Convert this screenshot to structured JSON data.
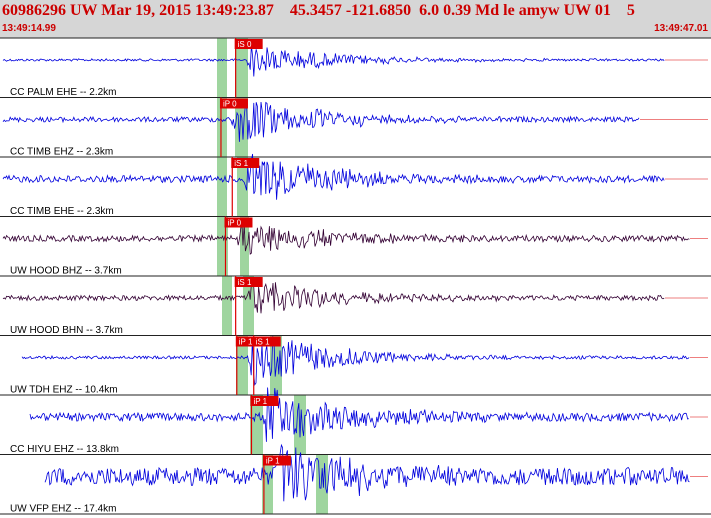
{
  "header": {
    "title": "60986296 UW Mar 19, 2015 13:49:23.87    45.3457 -121.6850  6.0 0.39 Md le amyw UW 01    5",
    "start_time": "13:49:14.99",
    "end_time": "13:49:47.01"
  },
  "colors": {
    "header_bg": "#d6d6d6",
    "header_text": "#cc0000",
    "trace_blue": "#0000dd",
    "trace_purple": "#330033",
    "pick_red": "#dd0000",
    "window_green": "#9fd59f",
    "separator": "#222222"
  },
  "traces": [
    {
      "label": "CC PALM EHE -- 2.2km",
      "picks": [
        {
          "label": "iS 0",
          "time": 18.2
        }
      ]
    },
    {
      "label": "CC TIMB EHZ -- 2.3km",
      "picks": [
        {
          "label": "iP 0",
          "time": 16.9
        }
      ]
    },
    {
      "label": "CC TIMB EHE -- 2.3km",
      "picks": [
        {
          "label": "iS 1",
          "time": 17.9
        }
      ]
    },
    {
      "label": "UW HOOD BHZ -- 3.7km",
      "picks": [
        {
          "label": "iP 0",
          "time": 17.3
        }
      ]
    },
    {
      "label": "UW HOOD BHN -- 3.7km",
      "picks": [
        {
          "label": "iS 1",
          "time": 18.2
        }
      ]
    },
    {
      "label": "UW TDH EHZ -- 10.4km",
      "picks": [
        {
          "label": "iP 1",
          "time": 18.3
        },
        {
          "label": "iS 1",
          "time": 19.8
        }
      ]
    },
    {
      "label": "CC HIYU EHZ -- 13.8km",
      "picks": [
        {
          "label": "iP 1",
          "time": 19.6
        }
      ]
    },
    {
      "label": "UW VFP EHZ -- 17.4km",
      "picks": [
        {
          "label": "iP 1",
          "time": 20.7
        }
      ]
    }
  ]
}
